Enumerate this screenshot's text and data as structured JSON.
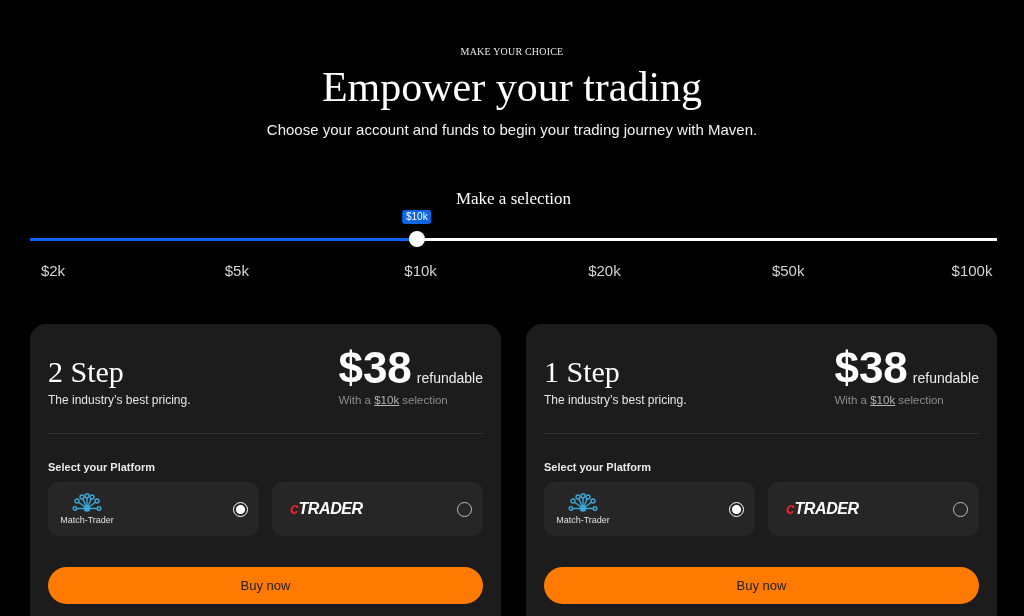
{
  "eyebrow": "MAKE YOUR CHOICE",
  "title": "Empower your trading",
  "subtitle": "Choose your account and funds to begin your trading journey with Maven.",
  "selection": {
    "heading": "Make a selection",
    "slider": {
      "level": 0.4,
      "value_label": "$10k"
    },
    "ticks": [
      "$2k",
      "$5k",
      "$10k",
      "$20k",
      "$50k",
      "$100k"
    ]
  },
  "plans": [
    {
      "name": "2 Step",
      "tagline": "The industry’s best pricing.",
      "price": "$38",
      "price_note": "refundable",
      "selection_note": {
        "before": "With a",
        "link": "$10k",
        "after": "selection"
      },
      "platform_heading": "Select your Platform",
      "platforms": [
        {
          "kind": "match-trader",
          "label": "Match-Trader",
          "selected": true
        },
        {
          "kind": "ctrader",
          "label": "cTRADER",
          "selected": false
        }
      ],
      "button": "Buy now"
    },
    {
      "name": "1 Step",
      "tagline": "The industry’s best pricing.",
      "price": "$38",
      "price_note": "refundable",
      "selection_note": {
        "before": "With a",
        "link": "$10k",
        "after": "selection"
      },
      "platform_heading": "Select your Platform",
      "platforms": [
        {
          "kind": "match-trader",
          "label": "Match-Trader",
          "selected": true
        },
        {
          "kind": "ctrader",
          "label": "cTRADER",
          "selected": false
        }
      ],
      "button": "Buy now"
    }
  ]
}
